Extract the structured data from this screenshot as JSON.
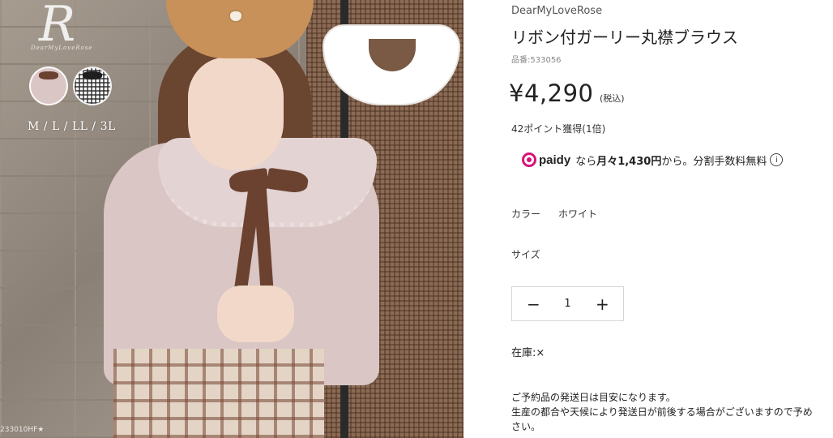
{
  "image": {
    "logo_letter": "R",
    "logo_script": "DearMyLoveRose",
    "sizes_overlay": "M / L / LL / 3L",
    "item_code": "233010HF★",
    "swatches": [
      "beige-brown-ribbon",
      "houndstooth-black-ribbon"
    ]
  },
  "product": {
    "brand": "DearMyLoveRose",
    "title": "リボン付ガーリー丸襟ブラウス",
    "sku": "品番:533056",
    "price": "¥4,290",
    "tax": "(税込)",
    "points": "42ポイント獲得(1倍)"
  },
  "paidy": {
    "logo_text": "paidy",
    "text_before": "なら",
    "amount": "月々1,430円",
    "text_after": "から。分割手数料無料",
    "info_icon": "i",
    "brand_color": "#d8137a"
  },
  "options": {
    "color_label": "カラー",
    "color_value": "ホワイト",
    "size_label": "サイズ"
  },
  "quantity": {
    "minus": "−",
    "value": "1",
    "plus": "+"
  },
  "stock": {
    "label": "在庫:",
    "value": "×"
  },
  "notice": {
    "line1": "ご予約品の発送日は目安になります。",
    "line2": "生産の都合や天候により発送日が前後する場合がございますので予め",
    "line3": "さい。"
  }
}
